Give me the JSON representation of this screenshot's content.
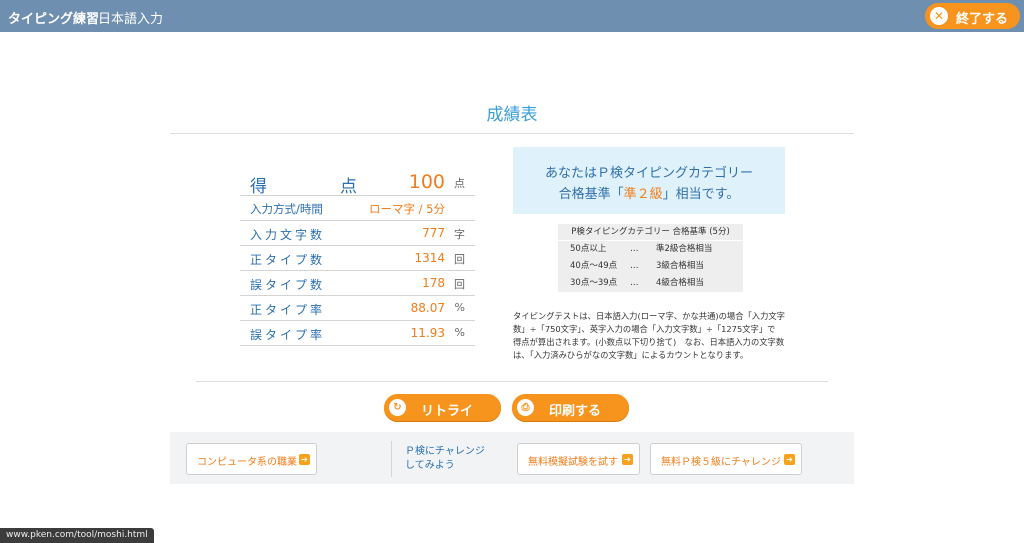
{
  "header": {
    "app_title": "タイピング練習",
    "subtitle": "日本語入力",
    "end_button": "終了する"
  },
  "page_title": "成績表",
  "score": {
    "rows": [
      {
        "label": "得　点",
        "value": "100",
        "unit": "点"
      },
      {
        "label": "入力方式/時間",
        "value": "ローマ字 / 5分",
        "unit": ""
      },
      {
        "label": "入力文字数",
        "value": "777",
        "unit": "字"
      },
      {
        "label": "正タイプ数",
        "value": "1314",
        "unit": "回"
      },
      {
        "label": "誤タイプ数",
        "value": "178",
        "unit": "回"
      },
      {
        "label": "正タイプ率",
        "value": "88.07",
        "unit": "%"
      },
      {
        "label": "誤タイプ率",
        "value": "11.93",
        "unit": "%"
      }
    ]
  },
  "category": {
    "line1": "あなたはＰ検タイピングカテゴリー",
    "line2_pre": "合格基準「",
    "line2_grade": "準２級",
    "line2_post": "」相当です。"
  },
  "criteria": {
    "header": "P検タイピングカテゴリー 合格基準 (5分)",
    "rows": [
      {
        "range": "50点以上",
        "dots": "…",
        "grade": "準2級合格相当"
      },
      {
        "range": "40点～49点",
        "dots": "…",
        "grade": "3級合格相当"
      },
      {
        "range": "30点～39点",
        "dots": "…",
        "grade": "4級合格相当"
      }
    ]
  },
  "notes": "タイピングテストは、日本語入力(ローマ字、かな共通)の場合「入力文字数」÷「750文字」、英字入力の場合「入力文字数」÷「1275文字」で 得点が算出されます。(小数点以下切り捨て)　なお、日本語入力の文字数は、「入力済みひらがなの文字数」によるカウントとなります。",
  "actions": {
    "retry": "リトライ",
    "print": "印刷する"
  },
  "footer": {
    "link1": "コンピュータ系の職業",
    "challenge_line1": "Ｐ検にチャレンジ",
    "challenge_line2": "してみよう",
    "link2": "無料模擬試験を試す",
    "link3": "無料Ｐ検５級にチャレンジ"
  },
  "status_url": "www.pken.com/tool/moshi.html",
  "colors": {
    "header_bg": "#6f8fb0",
    "accent_orange": "#f7941d",
    "title_blue": "#3b9fd8"
  }
}
